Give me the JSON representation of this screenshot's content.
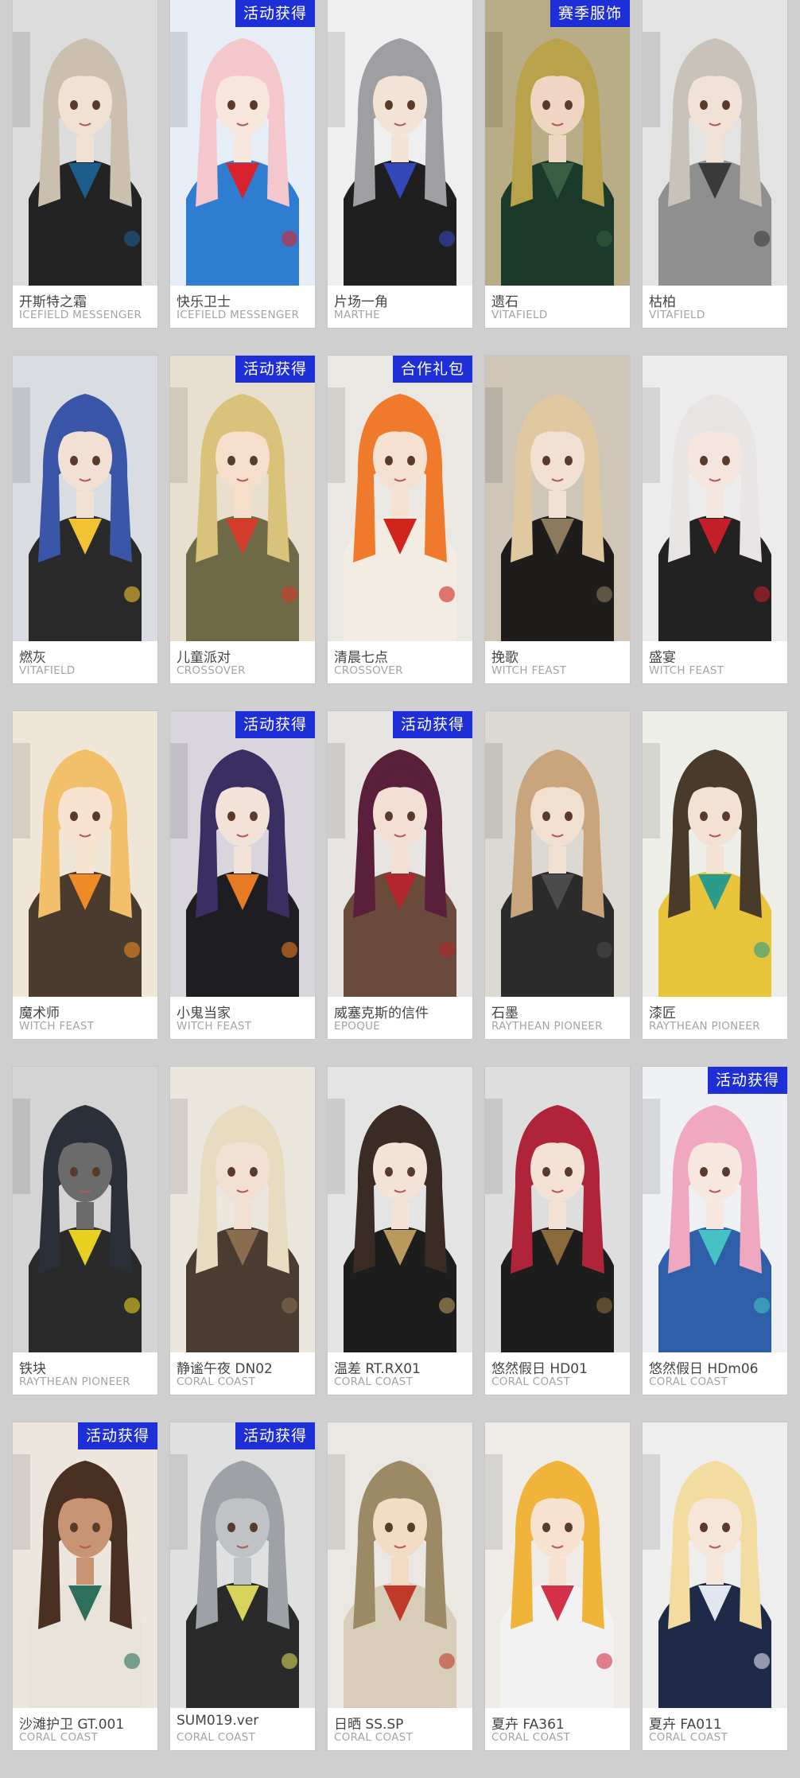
{
  "badge_colors": {
    "badge_bg": "#1f2fd8",
    "badge_text": "#ffffff"
  },
  "cards": [
    {
      "name": "开斯特之霜",
      "series": "ICEFIELD MESSENGER",
      "badge": "",
      "art": {
        "bg": "#dcdcdc",
        "hair": "#cbbfae",
        "cloth": "#232323",
        "accent": "#1c5d8c",
        "skin": "#f1e1d3"
      }
    },
    {
      "name": "快乐卫士",
      "series": "ICEFIELD MESSENGER",
      "badge": "活动获得",
      "art": {
        "bg": "#e6edf7",
        "hair": "#f3c7cc",
        "cloth": "#2f7dd1",
        "accent": "#d8222d",
        "skin": "#f7e6dc"
      }
    },
    {
      "name": "片场一角",
      "series": "MARTHE",
      "badge": "",
      "art": {
        "bg": "#efefef",
        "hair": "#9f9fa3",
        "cloth": "#1f1f1f",
        "accent": "#3447b8",
        "skin": "#f3e3d6"
      }
    },
    {
      "name": "遗石",
      "series": "VITAFIELD",
      "badge": "赛季服饰",
      "art": {
        "bg": "#b8ad86",
        "hair": "#b9a24c",
        "cloth": "#1b3a2a",
        "accent": "#3b5d42",
        "skin": "#efd6c2"
      }
    },
    {
      "name": "枯柏",
      "series": "VITAFIELD",
      "badge": "",
      "art": {
        "bg": "#e3e3e3",
        "hair": "#c8c2b8",
        "cloth": "#8f8f8f",
        "accent": "#3a3a3a",
        "skin": "#f0e2d7"
      }
    },
    {
      "name": "燃灰",
      "series": "VITAFIELD",
      "badge": "",
      "art": {
        "bg": "#d9dde2",
        "hair": "#3b56a8",
        "cloth": "#2a2a2a",
        "accent": "#f1c232",
        "skin": "#f3e0d4"
      }
    },
    {
      "name": "儿童派对",
      "series": "CROSSOVER",
      "badge": "活动获得",
      "art": {
        "bg": "#e9dfcf",
        "hair": "#d9c27a",
        "cloth": "#6e6a48",
        "accent": "#d33b2a",
        "skin": "#f5dfca"
      }
    },
    {
      "name": "清晨七点",
      "series": "CROSSOVER",
      "badge": "合作礼包",
      "art": {
        "bg": "#ebe8e4",
        "hair": "#ef7a2b",
        "cloth": "#f3ece3",
        "accent": "#d0241c",
        "skin": "#f6e0cf"
      }
    },
    {
      "name": "挽歌",
      "series": "WITCH FEAST",
      "badge": "",
      "art": {
        "bg": "#cfc6b8",
        "hair": "#e0c8a0",
        "cloth": "#1f1d1c",
        "accent": "#8c7a5e",
        "skin": "#f2e1d3"
      }
    },
    {
      "name": "盛宴",
      "series": "WITCH FEAST",
      "badge": "",
      "art": {
        "bg": "#ececec",
        "hair": "#e8e4e4",
        "cloth": "#222222",
        "accent": "#c21f2a",
        "skin": "#f4e6de"
      }
    },
    {
      "name": "魔术师",
      "series": "WITCH FEAST",
      "badge": "",
      "art": {
        "bg": "#f0e6d8",
        "hair": "#f2c06a",
        "cloth": "#4a3b2e",
        "accent": "#ef8a26",
        "skin": "#f7e3cf"
      }
    },
    {
      "name": "小鬼当家",
      "series": "WITCH FEAST",
      "badge": "活动获得",
      "art": {
        "bg": "#d8d5dd",
        "hair": "#3b2e63",
        "cloth": "#1e1e22",
        "accent": "#e67b23",
        "skin": "#f3e2d8"
      }
    },
    {
      "name": "威塞克斯的信件",
      "series": "EPOQUE",
      "badge": "活动获得",
      "art": {
        "bg": "#e8e4e2",
        "hair": "#5a1f3b",
        "cloth": "#6a4a3a",
        "accent": "#b1262f",
        "skin": "#f3dfd4"
      }
    },
    {
      "name": "石墨",
      "series": "RAYTHEAN PIONEER",
      "badge": "",
      "art": {
        "bg": "#dcd8d2",
        "hair": "#c9a57d",
        "cloth": "#2b2b2b",
        "accent": "#4a4a4a",
        "skin": "#f1dfd0"
      }
    },
    {
      "name": "漆匠",
      "series": "RAYTHEAN PIONEER",
      "badge": "",
      "art": {
        "bg": "#eeeee8",
        "hair": "#4a3a2a",
        "cloth": "#e8c43a",
        "accent": "#2c9b8a",
        "skin": "#f3e2d4"
      }
    },
    {
      "name": "铁块",
      "series": "RAYTHEAN PIONEER",
      "badge": "",
      "art": {
        "bg": "#d4d4d4",
        "hair": "#2b2f3a",
        "cloth": "#2a2a2a",
        "accent": "#e8d022",
        "skin": "#6b6b6b"
      }
    },
    {
      "name": "静谧午夜 DN02",
      "series": "CORAL COAST",
      "badge": "",
      "art": {
        "bg": "#ebe7df",
        "hair": "#e7dcc0",
        "cloth": "#4a3c30",
        "accent": "#8a6d4f",
        "skin": "#f2e1d2"
      }
    },
    {
      "name": "温差 RT.RX01",
      "series": "CORAL COAST",
      "badge": "",
      "art": {
        "bg": "#e4e4e4",
        "hair": "#3a2c24",
        "cloth": "#1d1d1d",
        "accent": "#b89a5e",
        "skin": "#f4e4d8"
      }
    },
    {
      "name": "悠然假日 HD01",
      "series": "CORAL COAST",
      "badge": "",
      "art": {
        "bg": "#dedede",
        "hair": "#b0243a",
        "cloth": "#1d1d1d",
        "accent": "#8a6a3a",
        "skin": "#f4e2d4"
      }
    },
    {
      "name": "悠然假日 HDm06",
      "series": "CORAL COAST",
      "badge": "活动获得",
      "art": {
        "bg": "#eef0f4",
        "hair": "#f0a8c0",
        "cloth": "#2f5fa8",
        "accent": "#46c1c4",
        "skin": "#f7e7de"
      }
    },
    {
      "name": "沙滩护卫 GT.001",
      "series": "CORAL COAST",
      "badge": "活动获得",
      "art": {
        "bg": "#ece6df",
        "hair": "#4a3020",
        "cloth": "#e9e2d8",
        "accent": "#2c6f5a",
        "skin": "#c99473"
      }
    },
    {
      "name": "SUM019.ver",
      "series": "CORAL COAST",
      "badge": "活动获得",
      "art": {
        "bg": "#e0e0e0",
        "hair": "#9ea2a6",
        "cloth": "#2a2a2a",
        "accent": "#d8d35a",
        "skin": "#bfc3c6"
      }
    },
    {
      "name": "日晒 SS.SP",
      "series": "CORAL COAST",
      "badge": "",
      "art": {
        "bg": "#ebe7e2",
        "hair": "#9c8a66",
        "cloth": "#d8cdb8",
        "accent": "#c03a2a",
        "skin": "#f2dcc6"
      }
    },
    {
      "name": "夏卉 FA361",
      "series": "CORAL COAST",
      "badge": "",
      "art": {
        "bg": "#efece8",
        "hair": "#f0b43a",
        "cloth": "#f2f2f2",
        "accent": "#d4304a",
        "skin": "#f6e2cf"
      }
    },
    {
      "name": "夏卉 FA011",
      "series": "CORAL COAST",
      "badge": "",
      "art": {
        "bg": "#eeeeee",
        "hair": "#f2dca0",
        "cloth": "#1f2a48",
        "accent": "#e2e6ee",
        "skin": "#f6e6da"
      }
    }
  ]
}
